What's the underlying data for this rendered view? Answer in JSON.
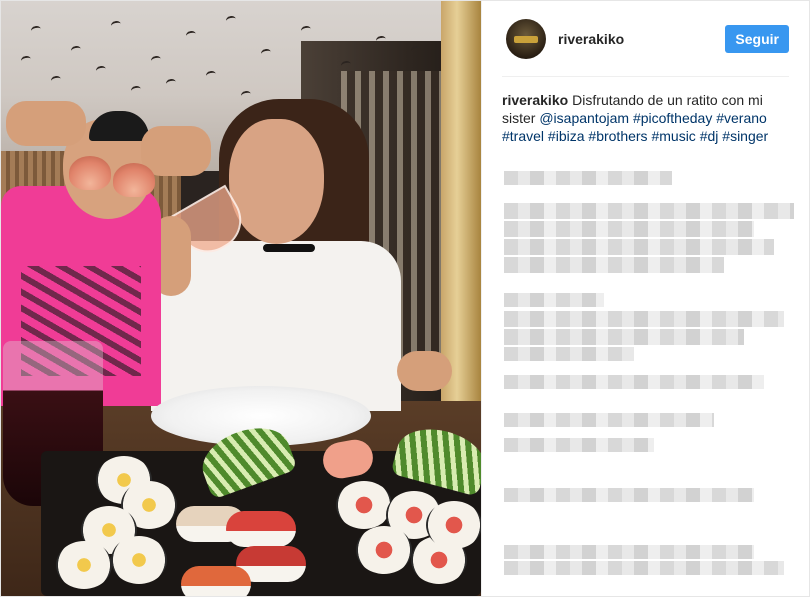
{
  "post": {
    "username": "riverakiko",
    "follow_label": "Seguir",
    "caption": {
      "username": "riverakiko",
      "text_parts": [
        {
          "type": "text",
          "value": "Disfrutando de un ratito con mi sister "
        },
        {
          "type": "tag",
          "value": "@isapantojam"
        },
        {
          "type": "text",
          "value": " "
        },
        {
          "type": "tag",
          "value": "#picoftheday"
        },
        {
          "type": "text",
          "value": " "
        },
        {
          "type": "tag",
          "value": "#verano"
        },
        {
          "type": "text",
          "value": " "
        },
        {
          "type": "tag",
          "value": "#travel"
        },
        {
          "type": "text",
          "value": " "
        },
        {
          "type": "tag",
          "value": "#ibiza"
        },
        {
          "type": "text",
          "value": " "
        },
        {
          "type": "tag",
          "value": "#brothers"
        },
        {
          "type": "text",
          "value": " "
        },
        {
          "type": "tag",
          "value": "#music"
        },
        {
          "type": "text",
          "value": " "
        },
        {
          "type": "tag",
          "value": "#dj"
        },
        {
          "type": "text",
          "value": " "
        },
        {
          "type": "tag",
          "value": "#singer"
        }
      ]
    }
  },
  "colors": {
    "follow_button": "#3897f0",
    "hashtag": "#003569",
    "text": "#262626"
  }
}
